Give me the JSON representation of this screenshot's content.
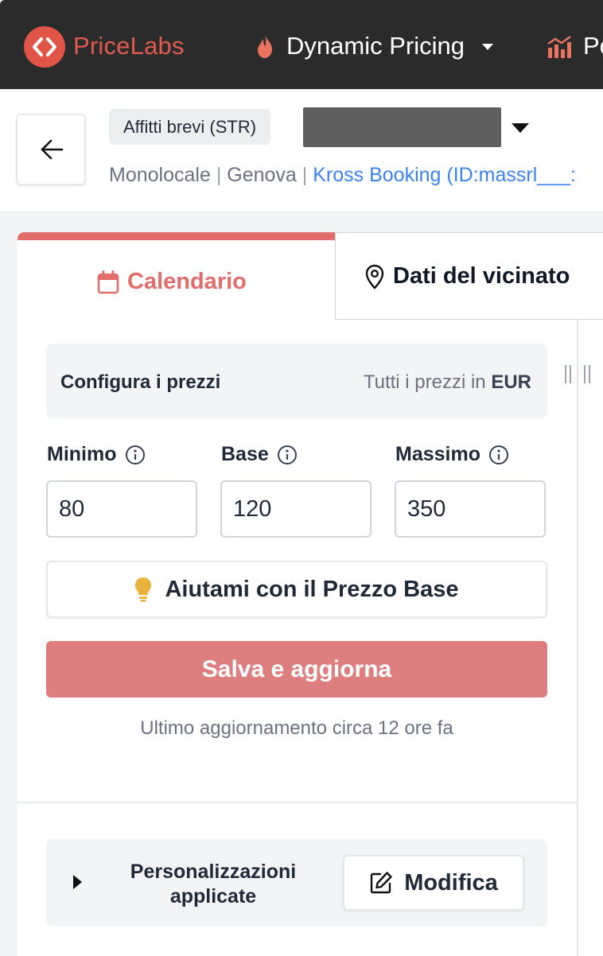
{
  "nav": {
    "brand": "PriceLabs",
    "items": [
      {
        "label": "Dynamic Pricing",
        "icon": "flame-icon"
      },
      {
        "label": "Po",
        "icon": "chart-icon"
      }
    ]
  },
  "listing": {
    "type_chip": "Affitti brevi (STR)",
    "room_type": "Monolocale",
    "city": "Genova",
    "pms": "Kross Booking (ID:massrl___:",
    "separator": "|"
  },
  "tabs": [
    {
      "label": "Calendario",
      "icon": "calendar-icon",
      "active": true
    },
    {
      "label": "Dati del vicinato",
      "icon": "location-pin-icon",
      "active": false
    }
  ],
  "pricing": {
    "title": "Configura i prezzi",
    "currency_prefix": "Tutti i prezzi in",
    "currency": "EUR",
    "fields": [
      {
        "label": "Minimo",
        "value": "80"
      },
      {
        "label": "Base",
        "value": "120"
      },
      {
        "label": "Massimo",
        "value": "350"
      }
    ],
    "help_label": "Aiutami con il Prezzo Base",
    "save_label": "Salva e aggiorna",
    "last_update": "Ultimo aggiornamento circa 12 ore fa"
  },
  "customizations": {
    "title": "Personalizzazioni applicate",
    "edit_label": "Modifica"
  },
  "colors": {
    "brand": "#e05548",
    "accent": "#e26d6a",
    "save_button": "#df7e7e",
    "link": "#3b82f6",
    "topbar": "#2b2b2b"
  }
}
